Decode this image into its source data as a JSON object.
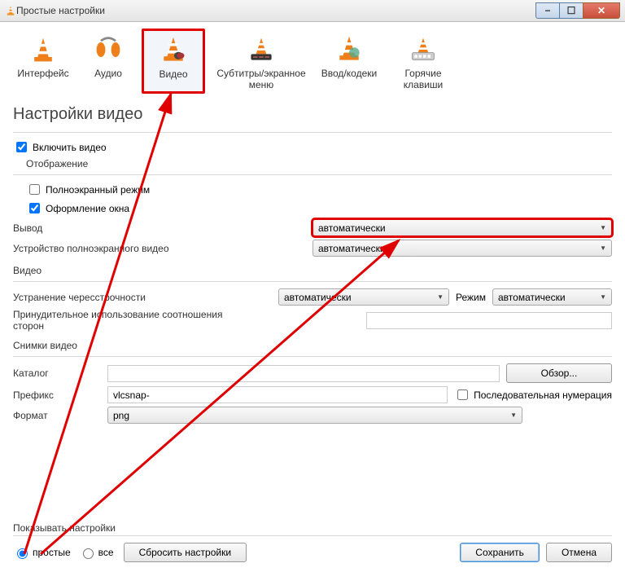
{
  "window": {
    "title": "Простые настройки"
  },
  "toolbar": {
    "items": [
      {
        "label": "Интерфейс"
      },
      {
        "label": "Аудио"
      },
      {
        "label": "Видео"
      },
      {
        "label": "Субтитры/экранное меню"
      },
      {
        "label": "Ввод/кодеки"
      },
      {
        "label": "Горячие клавиши"
      }
    ]
  },
  "heading": "Настройки видео",
  "enable_video": "Включить видео",
  "display": {
    "title": "Отображение",
    "fullscreen": "Полноэкранный режим",
    "decorations": "Оформление окна",
    "output_label": "Вывод",
    "output_value": "автоматически",
    "fsdevice_label": "Устройство полноэкранного видео",
    "fsdevice_value": "автоматически"
  },
  "video": {
    "title": "Видео",
    "deint_label": "Устранение чересстрочности",
    "deint_value": "автоматически",
    "mode_label": "Режим",
    "mode_value": "автоматически",
    "aspect_label": "Принудительное использование соотношения сторон",
    "aspect_value": ""
  },
  "snap": {
    "title": "Снимки видео",
    "dir_label": "Каталог",
    "dir_value": "",
    "browse": "Обзор...",
    "prefix_label": "Префикс",
    "prefix_value": "vlcsnap-",
    "seq_label": "Последовательная нумерация",
    "format_label": "Формат",
    "format_value": "png"
  },
  "footer": {
    "show_label": "Показывать настройки",
    "simple": "простые",
    "all": "все",
    "reset": "Сбросить настройки",
    "save": "Сохранить",
    "cancel": "Отмена"
  }
}
